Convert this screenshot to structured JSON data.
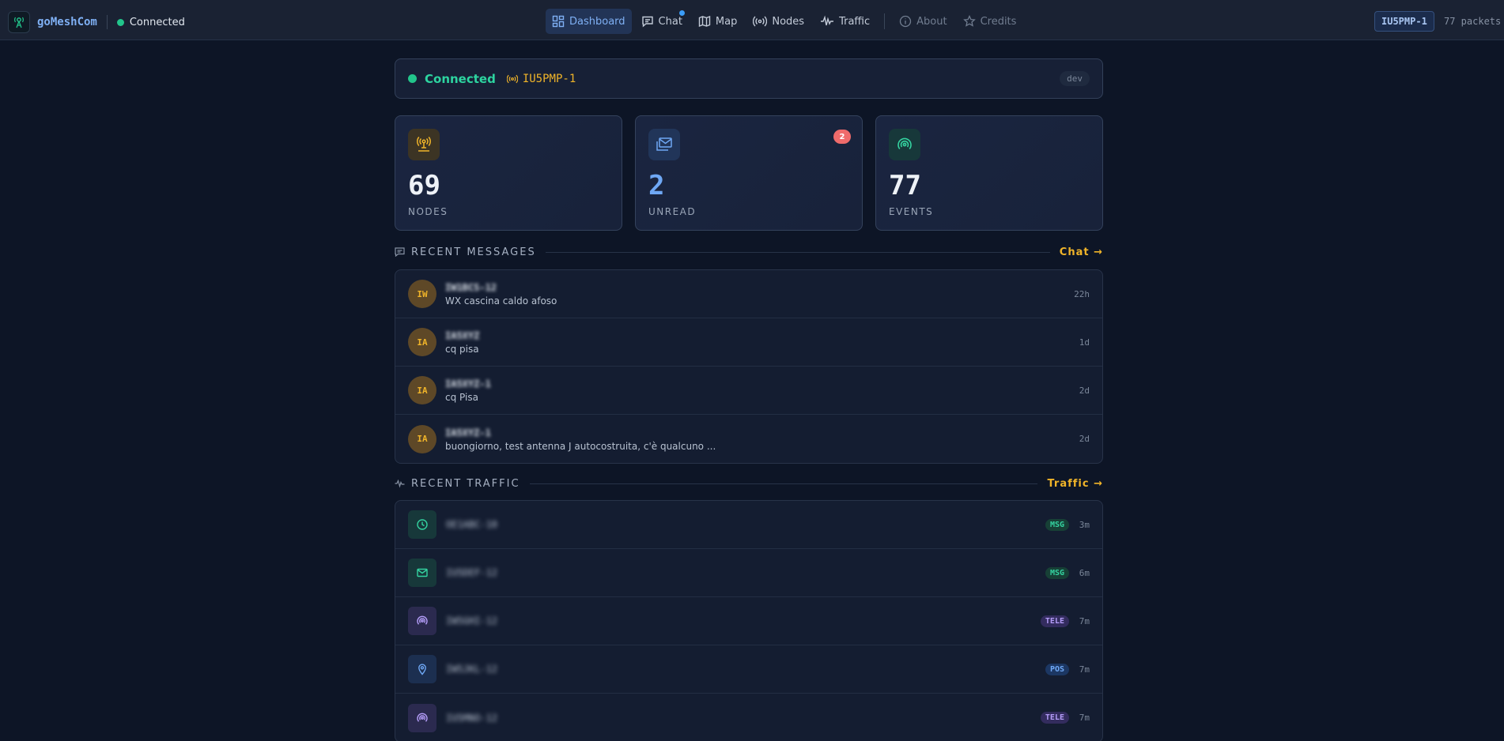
{
  "app": {
    "name": "goMeshCom",
    "connection_status": "Connected",
    "callsign": "IU5PMP-1",
    "packets": "77 packets"
  },
  "nav": {
    "dashboard": "Dashboard",
    "chat": "Chat",
    "map": "Map",
    "nodes": "Nodes",
    "traffic": "Traffic",
    "about": "About",
    "credits": "Credits"
  },
  "status": {
    "label": "Connected",
    "callsign": "IU5PMP-1",
    "env": "dev"
  },
  "stats": {
    "nodes": {
      "value": "69",
      "caption": "NODES"
    },
    "unread": {
      "value": "2",
      "caption": "UNREAD",
      "badge": "2"
    },
    "events": {
      "value": "77",
      "caption": "EVENTS"
    }
  },
  "recent_messages": {
    "title": "RECENT MESSAGES",
    "link": "Chat →",
    "items": [
      {
        "initials": "IW",
        "sender": "IW1BCS-12",
        "text": "WX cascina caldo afoso",
        "time": "22h"
      },
      {
        "initials": "IA",
        "sender": "IA5XYZ",
        "text": "cq pisa",
        "time": "1d"
      },
      {
        "initials": "IA",
        "sender": "IA5XYZ-1",
        "text": "cq Pisa",
        "time": "2d"
      },
      {
        "initials": "IA",
        "sender": "IA5XYZ-1",
        "text": "buongiorno, test antenna J autocostruita, c'è qualcuno ...",
        "time": "2d"
      }
    ]
  },
  "recent_traffic": {
    "title": "RECENT TRAFFIC",
    "link": "Traffic →",
    "items": [
      {
        "icon": "clock-icon",
        "name": "OE1ABC-10",
        "tag": "MSG",
        "time": "3m"
      },
      {
        "icon": "mail-icon",
        "name": "IU5DEF-12",
        "tag": "MSG",
        "time": "6m"
      },
      {
        "icon": "signal-icon",
        "name": "IW5GHI-12",
        "tag": "TELE",
        "time": "7m"
      },
      {
        "icon": "pin-icon",
        "name": "IW5JKL-12",
        "tag": "POS",
        "time": "7m"
      },
      {
        "icon": "signal-icon",
        "name": "IU5MNO-12",
        "tag": "TELE",
        "time": "7m"
      }
    ]
  },
  "colors": {
    "accent_blue": "#7fb0f4",
    "accent_amber": "#f0b429",
    "accent_green": "#22c58b",
    "badge_red": "#ef6b6b"
  }
}
